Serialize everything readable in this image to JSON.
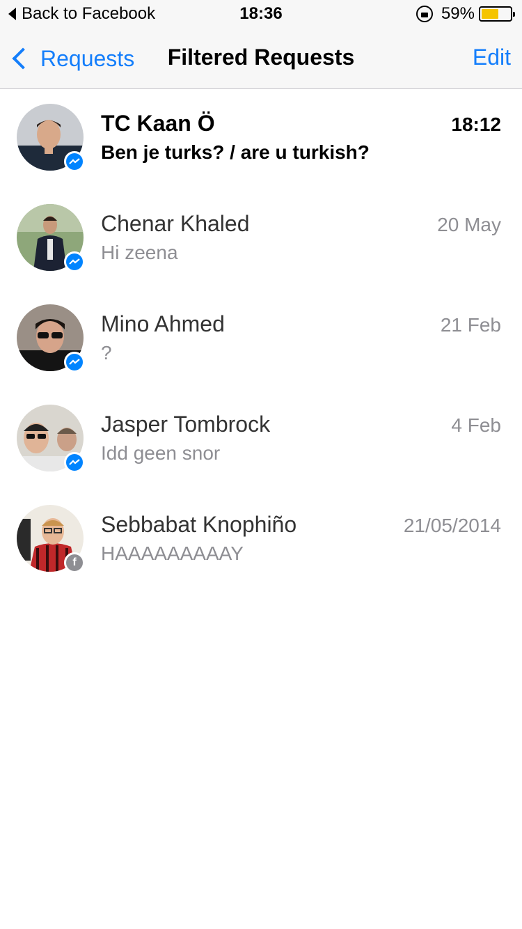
{
  "status_bar": {
    "back_label": "Back to Facebook",
    "time": "18:36",
    "battery_text": "59%",
    "battery_level": 0.59,
    "battery_color": "#f5c400"
  },
  "nav": {
    "back_label": "Requests",
    "title": "Filtered Requests",
    "edit_label": "Edit",
    "accent_color": "#147efb"
  },
  "conversations": [
    {
      "name": "TC Kaan Ö",
      "message": "Ben je turks? / are u turkish?",
      "time": "18:12",
      "unread": true,
      "badge": "messenger-icon"
    },
    {
      "name": "Chenar Khaled",
      "message": "Hi zeena",
      "time": "20 May",
      "unread": false,
      "badge": "messenger-icon"
    },
    {
      "name": "Mino Ahmed",
      "message": "?",
      "time": "21 Feb",
      "unread": false,
      "badge": "messenger-icon"
    },
    {
      "name": "Jasper Tombrock",
      "message": "Idd geen snor",
      "time": "4 Feb",
      "unread": false,
      "badge": "messenger-icon"
    },
    {
      "name": "Sebbabat Knophiño",
      "message": "HAAAAAAAAAY",
      "time": "21/05/2014",
      "unread": false,
      "badge": "facebook-icon"
    }
  ]
}
